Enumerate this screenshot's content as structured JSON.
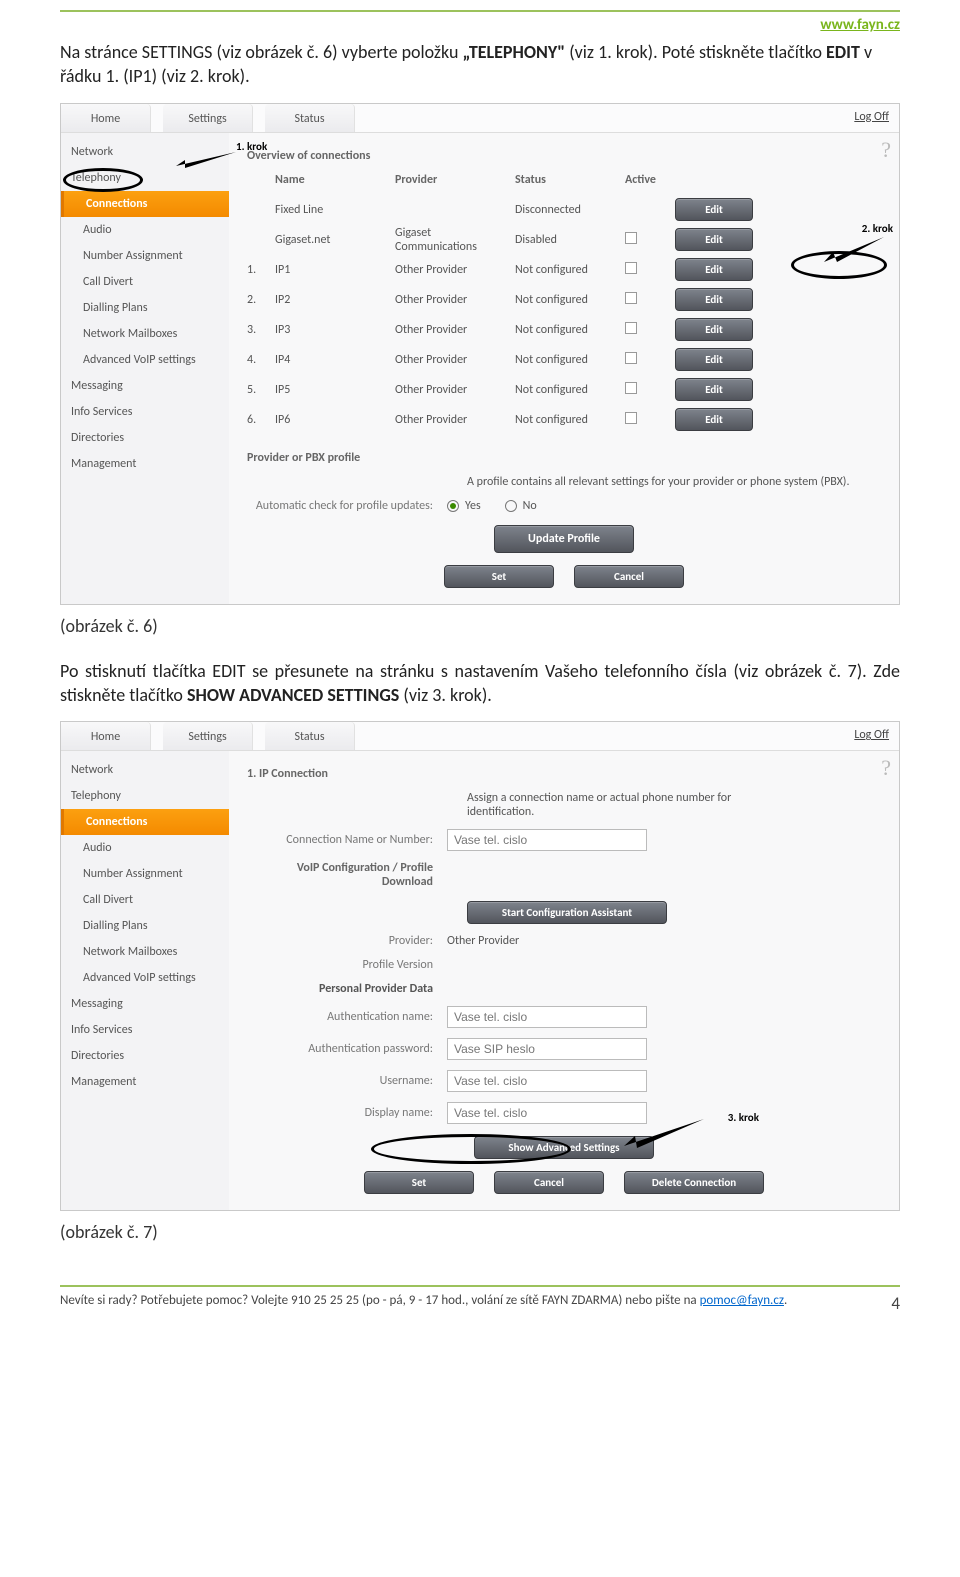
{
  "header_url": "www.fayn.cz",
  "para1a": "Na stránce SETTINGS (viz obrázek č. 6) vyberte položku ",
  "para1b": "„TELEPHONY\"",
  "para1c": " (viz 1. krok). Poté stiskněte tlačítko ",
  "para1d": "EDIT",
  "para1e": " v řádku 1. (IP1) (viz 2. krok).",
  "shot1": {
    "tabs": [
      "Home",
      "Settings",
      "Status"
    ],
    "logoff": "Log Off",
    "krok1": "1. krok",
    "krok2": "2. krok",
    "sidebar": {
      "items": [
        {
          "label": "Network",
          "sub": false,
          "active": false
        },
        {
          "label": "Telephony",
          "sub": false,
          "active": false
        },
        {
          "label": "Connections",
          "sub": true,
          "active": true
        },
        {
          "label": "Audio",
          "sub": true,
          "active": false
        },
        {
          "label": "Number Assignment",
          "sub": true,
          "active": false
        },
        {
          "label": "Call Divert",
          "sub": true,
          "active": false
        },
        {
          "label": "Dialling Plans",
          "sub": true,
          "active": false
        },
        {
          "label": "Network Mailboxes",
          "sub": true,
          "active": false
        },
        {
          "label": "Advanced VoIP settings",
          "sub": true,
          "active": false
        },
        {
          "label": "Messaging",
          "sub": false,
          "active": false
        },
        {
          "label": "Info Services",
          "sub": false,
          "active": false
        },
        {
          "label": "Directories",
          "sub": false,
          "active": false
        },
        {
          "label": "Management",
          "sub": false,
          "active": false
        }
      ]
    },
    "overview_title": "Overview of connections",
    "cols": {
      "name": "Name",
      "provider": "Provider",
      "status": "Status",
      "active": "Active"
    },
    "rows": [
      {
        "num": "",
        "name": "Fixed Line",
        "provider": "",
        "status": "Disconnected",
        "chk": false,
        "btn": "Edit"
      },
      {
        "num": "",
        "name": "Gigaset.net",
        "provider": "Gigaset Communications",
        "status": "Disabled",
        "chk": true,
        "btn": "Edit"
      },
      {
        "num": "1.",
        "name": "IP1",
        "provider": "Other Provider",
        "status": "Not configured",
        "chk": true,
        "btn": "Edit"
      },
      {
        "num": "2.",
        "name": "IP2",
        "provider": "Other Provider",
        "status": "Not configured",
        "chk": true,
        "btn": "Edit"
      },
      {
        "num": "3.",
        "name": "IP3",
        "provider": "Other Provider",
        "status": "Not configured",
        "chk": true,
        "btn": "Edit"
      },
      {
        "num": "4.",
        "name": "IP4",
        "provider": "Other Provider",
        "status": "Not configured",
        "chk": true,
        "btn": "Edit"
      },
      {
        "num": "5.",
        "name": "IP5",
        "provider": "Other Provider",
        "status": "Not configured",
        "chk": true,
        "btn": "Edit"
      },
      {
        "num": "6.",
        "name": "IP6",
        "provider": "Other Provider",
        "status": "Not configured",
        "chk": true,
        "btn": "Edit"
      }
    ],
    "profile_hdr": "Provider or PBX profile",
    "profile_note": "A profile contains all relevant settings for your provider or phone system (PBX).",
    "autochk_lbl": "Automatic check for profile updates:",
    "yes": "Yes",
    "no": "No",
    "update_btn": "Update Profile",
    "set_btn": "Set",
    "cancel_btn": "Cancel"
  },
  "caption1": "(obrázek č. 6)",
  "para2a": "Po stisknutí tlačítka EDIT se přesunete na stránku s nastavením Vašeho telefonního čísla (viz obrázek č. 7). Zde stiskněte tlačítko ",
  "para2b": "SHOW ADVANCED SETTINGS",
  "para2c": " (viz 3. krok).",
  "shot2": {
    "tabs": [
      "Home",
      "Settings",
      "Status"
    ],
    "logoff": "Log Off",
    "krok3": "3. krok",
    "sidebar": {
      "items": [
        {
          "label": "Network",
          "sub": false,
          "active": false
        },
        {
          "label": "Telephony",
          "sub": false,
          "active": false
        },
        {
          "label": "Connections",
          "sub": true,
          "active": true
        },
        {
          "label": "Audio",
          "sub": true,
          "active": false
        },
        {
          "label": "Number Assignment",
          "sub": true,
          "active": false
        },
        {
          "label": "Call Divert",
          "sub": true,
          "active": false
        },
        {
          "label": "Dialling Plans",
          "sub": true,
          "active": false
        },
        {
          "label": "Network Mailboxes",
          "sub": true,
          "active": false
        },
        {
          "label": "Advanced VoIP settings",
          "sub": true,
          "active": false
        },
        {
          "label": "Messaging",
          "sub": false,
          "active": false
        },
        {
          "label": "Info Services",
          "sub": false,
          "active": false
        },
        {
          "label": "Directories",
          "sub": false,
          "active": false
        },
        {
          "label": "Management",
          "sub": false,
          "active": false
        }
      ]
    },
    "title": "1. IP Connection",
    "assign_note": "Assign a connection name or actual phone number for identification.",
    "fields": {
      "conn_name_lbl": "Connection Name or Number:",
      "conn_name_val": "Vase tel. cislo",
      "voip_hdr": "VoIP Configuration / Profile Download",
      "start_btn": "Start Configuration Assistant",
      "provider_lbl": "Provider:",
      "provider_val": "Other Provider",
      "profver_lbl": "Profile Version",
      "personal_hdr": "Personal Provider Data",
      "authn_lbl": "Authentication name:",
      "authn_val": "Vase tel. cislo",
      "authp_lbl": "Authentication password:",
      "authp_val": "Vase SIP heslo",
      "user_lbl": "Username:",
      "user_val": "Vase tel. cislo",
      "disp_lbl": "Display name:",
      "disp_val": "Vase tel. cislo"
    },
    "show_btn": "Show Advanced Settings",
    "set_btn": "Set",
    "cancel_btn": "Cancel",
    "delete_btn": "Delete Connection"
  },
  "caption2": "(obrázek č. 7)",
  "footer_text_a": "Nevíte si rady? Potřebujete pomoc? Volejte 910 25 25 25 (po - pá, 9 - 17 hod., volání ze sítě FAYN ZDARMA) nebo pište na ",
  "footer_mail": "pomoc@fayn.cz",
  "footer_text_b": ".",
  "page_num": "4"
}
